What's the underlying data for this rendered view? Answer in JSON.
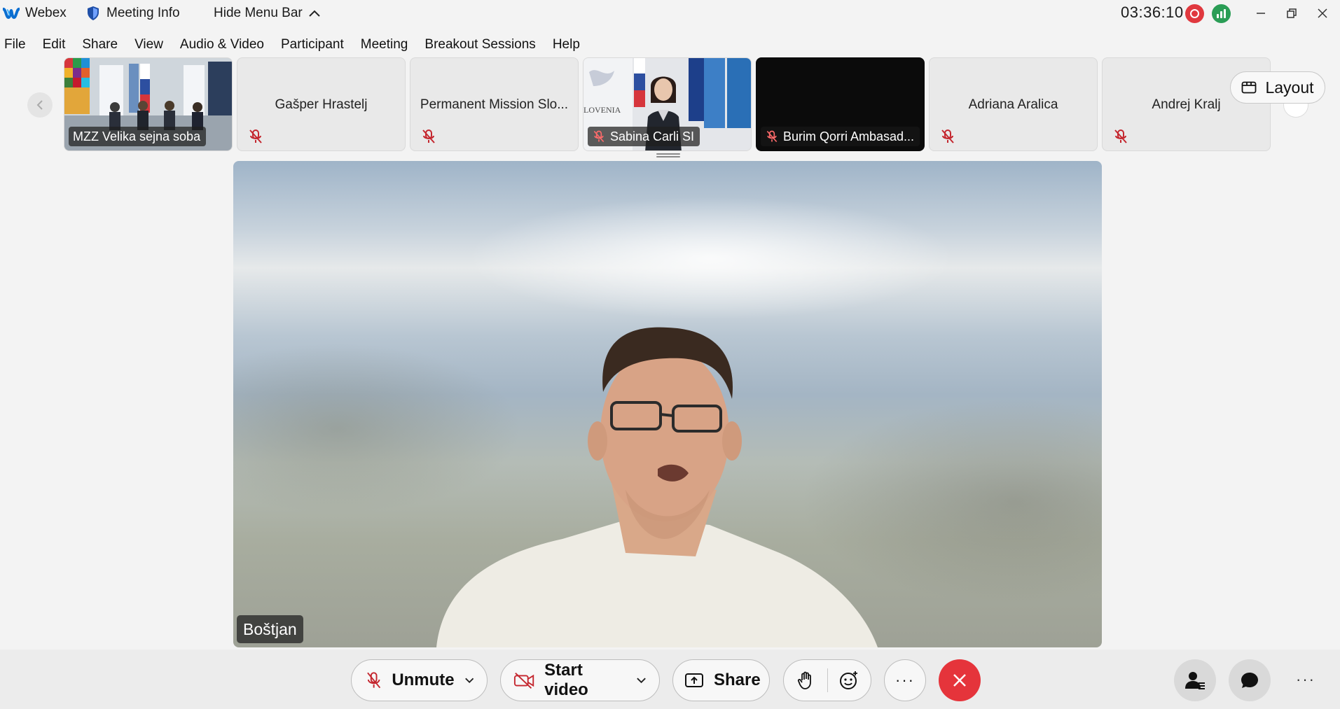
{
  "titlebar": {
    "app_name": "Webex",
    "meeting_info": "Meeting Info",
    "hide_menu": "Hide Menu Bar",
    "clock": "03:36:10"
  },
  "menu": [
    "File",
    "Edit",
    "Share",
    "View",
    "Audio & Video",
    "Participant",
    "Meeting",
    "Breakout Sessions",
    "Help"
  ],
  "filmstrip": {
    "tiles": [
      {
        "name": "MZZ Velika sejna soba",
        "has_video": true,
        "muted": false
      },
      {
        "name": "Gašper Hrastelj",
        "has_video": false,
        "muted": true
      },
      {
        "name": "Permanent Mission Slo...",
        "has_video": false,
        "muted": true
      },
      {
        "name": "Sabina Carli SI",
        "has_video": true,
        "muted": true
      },
      {
        "name": "Burim Qorri Ambasad...",
        "has_video": true,
        "muted": true
      },
      {
        "name": "Adriana Aralica",
        "has_video": false,
        "muted": true
      },
      {
        "name": "Andrej Kralj",
        "has_video": false,
        "muted": true
      }
    ],
    "layout_label": "Layout"
  },
  "main_video": {
    "speaker_name": "Boštjan"
  },
  "controls": {
    "unmute": "Unmute",
    "start_video": "Start video",
    "share": "Share",
    "more": "···",
    "right_more": "···"
  },
  "colors": {
    "record": "#e0383e",
    "network": "#2a9d55",
    "leave": "#e5343b",
    "mute_icon": "#c4262e",
    "webex_blue": "#0a6ed1"
  }
}
